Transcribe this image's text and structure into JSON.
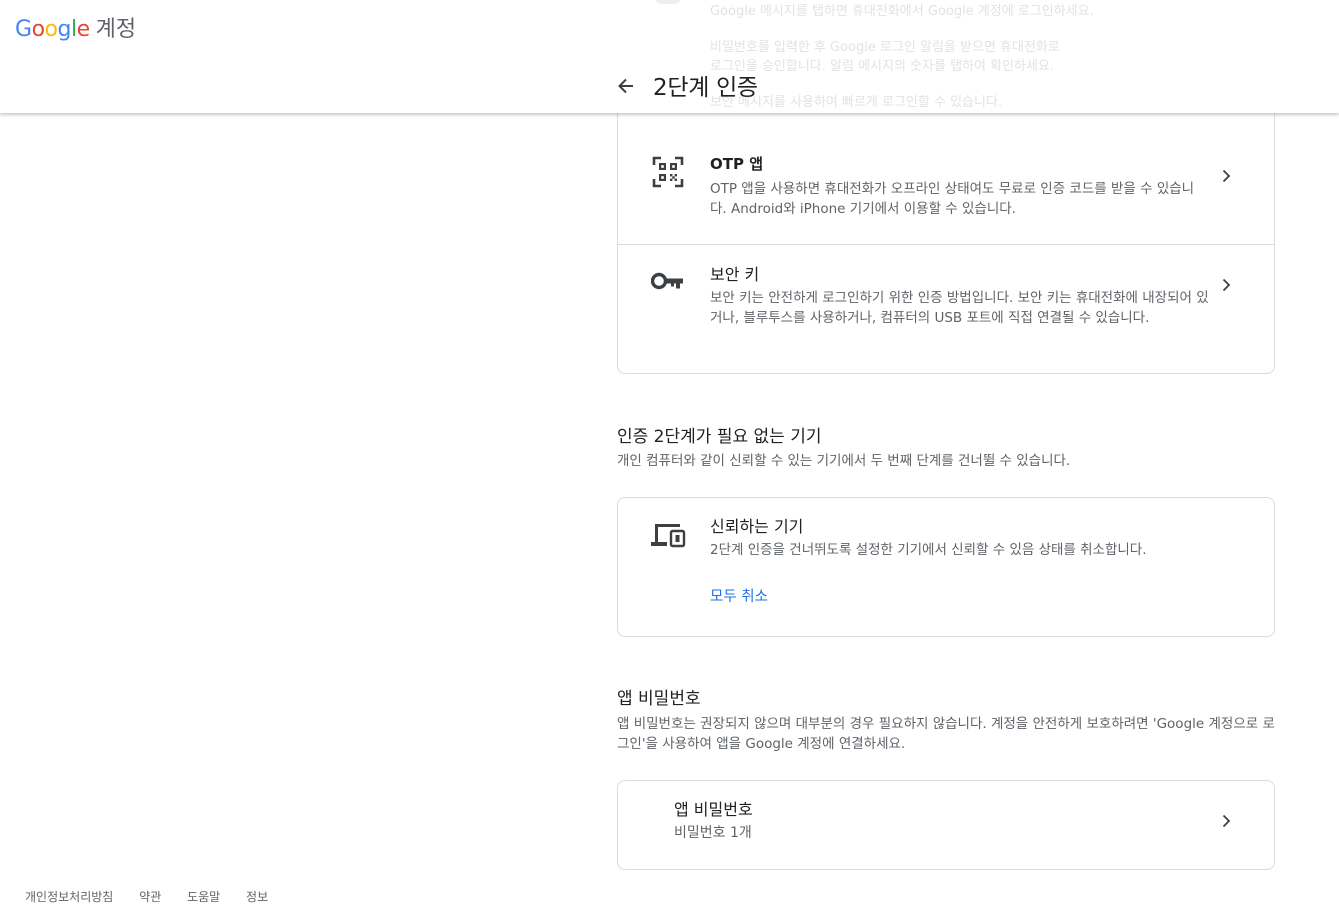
{
  "header": {
    "logo_text": "Google",
    "product_name": "계정",
    "page_title": "2단계 인증",
    "ghost_lines": [
      "Google 메시지를 탭하면 휴대전화에서 Google 계정에 로그인하세요.",
      "비밀번호를 입력한 후 Google 로그인 알림을 받으면 휴대전화로",
      "로그인을 승인합니다. 알림 메시지의 숫자를 탭하여 확인하세요.",
      "보안 메시지를 사용하여 빠르게 로그인할 수 있습니다."
    ]
  },
  "methods": [
    {
      "title": "OTP 앱",
      "desc": "OTP 앱을 사용하면 휴대전화가 오프라인 상태여도 무료로 인증 코드를 받을 수 있습니다. Android와 iPhone 기기에서 이용할 수 있습니다.",
      "icon": "qr-code-icon"
    },
    {
      "title": "보안 키",
      "desc": "보안 키는 안전하게 로그인하기 위한 인증 방법입니다. 보안 키는 휴대전화에 내장되어 있거나, 블루투스를 사용하거나, 컴퓨터의 USB 포트에 직접 연결될 수 있습니다.",
      "icon": "key-icon"
    }
  ],
  "trusted_section": {
    "title": "인증 2단계가 필요 없는 기기",
    "desc": "개인 컴퓨터와 같이 신뢰할 수 있는 기기에서 두 번째 단계를 건너뛸 수 있습니다.",
    "card_title": "신뢰하는 기기",
    "card_desc": "2단계 인증을 건너뛰도록 설정한 기기에서 신뢰할 수 있음 상태를 취소합니다.",
    "link": "모두 취소",
    "icon": "devices-icon"
  },
  "app_password_section": {
    "title": "앱 비밀번호",
    "desc": "앱 비밀번호는 권장되지 않으며 대부분의 경우 필요하지 않습니다. 계정을 안전하게 보호하려면 'Google 계정으로 로그인'을 사용하여 앱을 Google 계정에 연결하세요.",
    "card_title": "앱 비밀번호",
    "card_subtitle": "비밀번호 1개"
  },
  "footer": {
    "links": [
      "개인정보처리방침",
      "약관",
      "도움말",
      "정보"
    ]
  },
  "colors": {
    "link": "#1a73e8",
    "text": "#202124",
    "secondary": "#5f6368",
    "border": "#dadce0"
  }
}
